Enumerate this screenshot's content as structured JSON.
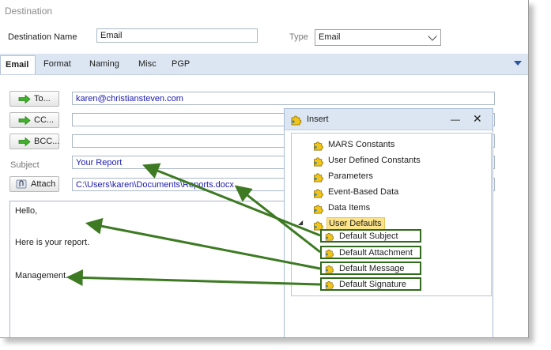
{
  "window": {
    "title": "Destination"
  },
  "form": {
    "destination_name_label": "Destination Name",
    "destination_name_value": "Email",
    "type_label": "Type",
    "type_value": "Email"
  },
  "tabs": [
    {
      "label": "Email",
      "active": true
    },
    {
      "label": "Format"
    },
    {
      "label": "Naming"
    },
    {
      "label": "Misc"
    },
    {
      "label": "PGP"
    }
  ],
  "email": {
    "to_button": "To...",
    "to_value": "karen@christiansteven.com",
    "cc_button": "CC...",
    "bcc_button": "BCC...",
    "subject_label": "Subject",
    "subject_value": "Your Report",
    "attach_button": "Attach",
    "attach_value": "C:\\Users\\karen\\Documents\\Reports.docx",
    "message_lines": [
      "Hello,",
      "Here is your report.",
      "Management."
    ]
  },
  "insert_panel": {
    "title": "Insert",
    "items": [
      "MARS Constants",
      "User Defined Constants",
      "Parameters",
      "Event-Based Data",
      "Data Items",
      "User Defaults"
    ],
    "children": [
      "Default Subject",
      "Default Attachment",
      "Default Message",
      "Default Signature"
    ]
  },
  "colors": {
    "tab_bar": "#dce6f2",
    "input_text": "#1b1bb0",
    "highlight_border": "#2f6b1a",
    "arrow": "#3d7a23",
    "selection": "#fbe38b"
  },
  "icons": {
    "insert": "puzzle-icon",
    "buttons": "green-arrow-icon",
    "attach": "paperclip-icon"
  }
}
